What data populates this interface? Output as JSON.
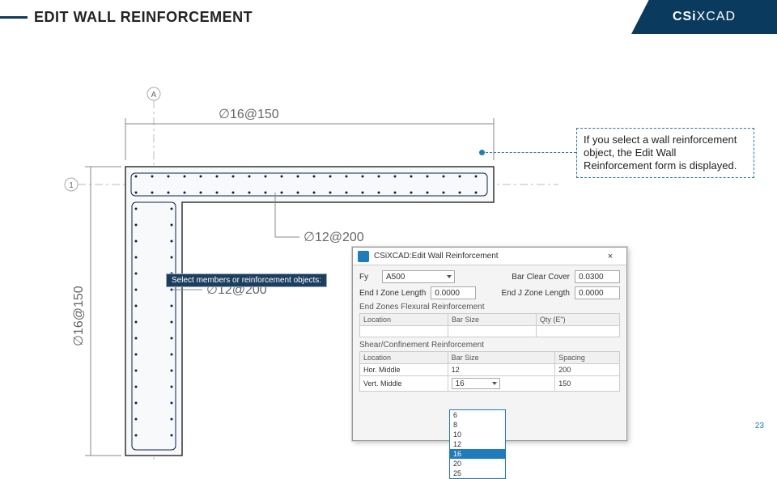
{
  "page": {
    "title": "EDIT WALL REINFORCEMENT",
    "brand_a": "CSi",
    "brand_b": "XCAD",
    "number": "23"
  },
  "drawing": {
    "top_dim": "∅16@150",
    "left_dim": "∅16@150",
    "leader1": "∅12@200",
    "leader2": "∅12@200",
    "grid_a": "A",
    "grid_1": "1"
  },
  "callout": {
    "text": "If you select a wall reinforcement object, the Edit Wall Reinforcement form is displayed."
  },
  "prompt": {
    "text": "Select members or reinforcement objects:"
  },
  "dialog": {
    "title": "CSiXCAD:Edit Wall Reinforcement",
    "fy_label": "Fy",
    "fy_value": "A500",
    "cover_label": "Bar Clear Cover",
    "cover_value": "0.0300",
    "endi_label": "End I Zone Length",
    "endi_value": "0.0000",
    "endj_label": "End J Zone Length",
    "endj_value": "0.0000",
    "section1": "End Zones Flexural Reinforcement",
    "col_location": "Location",
    "col_barsize": "Bar Size",
    "col_qty": "Qty (E\")",
    "section2": "Shear/Confinement Reinforcement",
    "col_spacing": "Spacing",
    "row_hor": "Hor. Middle",
    "row_vert": "Vert. Middle",
    "hor_bar": "12",
    "hor_spc": "200",
    "vert_bar": "16",
    "vert_spc": "150",
    "close": "×",
    "options": [
      "6",
      "8",
      "10",
      "12",
      "16",
      "20",
      "25"
    ],
    "selected": "16"
  }
}
